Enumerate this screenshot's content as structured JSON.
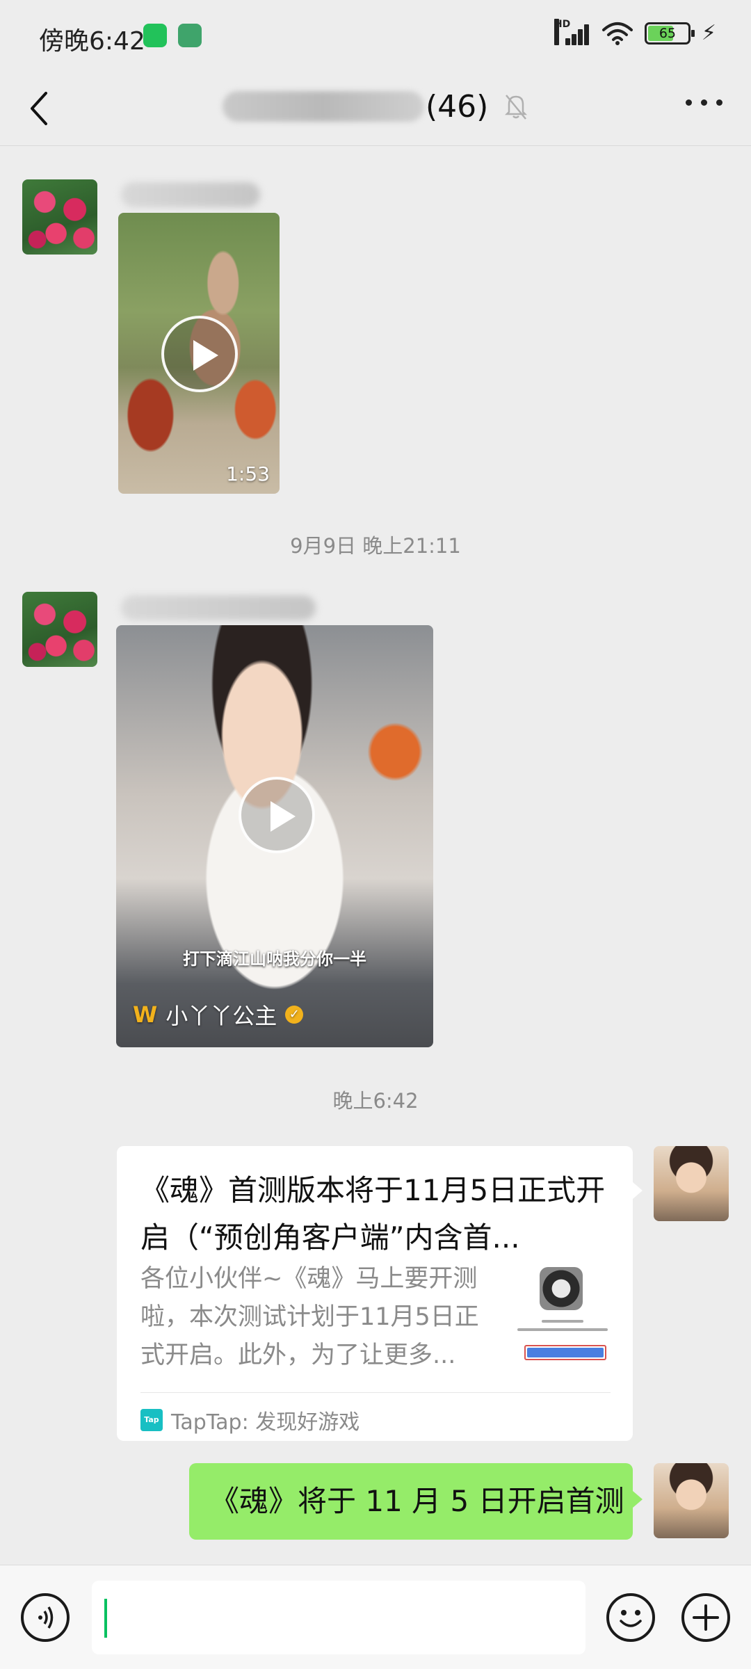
{
  "status_bar": {
    "time": "傍晚6:42",
    "network": "HD",
    "battery_level": 65,
    "battery_label": "65"
  },
  "header": {
    "title_count": "(46)"
  },
  "messages": {
    "video1": {
      "duration": "1:53"
    },
    "timestamp1": "9月9日 晚上21:11",
    "video2": {
      "subtitle": "打下滴江山呐我分你一半",
      "author": "小丫丫公主"
    },
    "timestamp2": "晚上6:42",
    "link_card": {
      "title": "《魂》首测版本将于11月5日正式开启（“预创角客户端”内含首...",
      "description": "各位小伙伴~《魂》马上要开测啦，本次测试计划于11月5日正式开启。此外，为了让更多...",
      "source_icon_label": "Tap",
      "source": "TapTap: 发现好游戏"
    },
    "text_bubble": "《魂》将于 11 月 5 日开启首测"
  },
  "input_bar": {
    "placeholder": ""
  },
  "colors": {
    "background": "#ededed",
    "bubble_green": "#95ec69",
    "accent_green": "#07c160",
    "taptap": "#18bfc3"
  },
  "icons": [
    "back-icon",
    "mute-icon",
    "more-icon",
    "play-icon",
    "voice-icon",
    "emoji-icon",
    "plus-icon"
  ]
}
